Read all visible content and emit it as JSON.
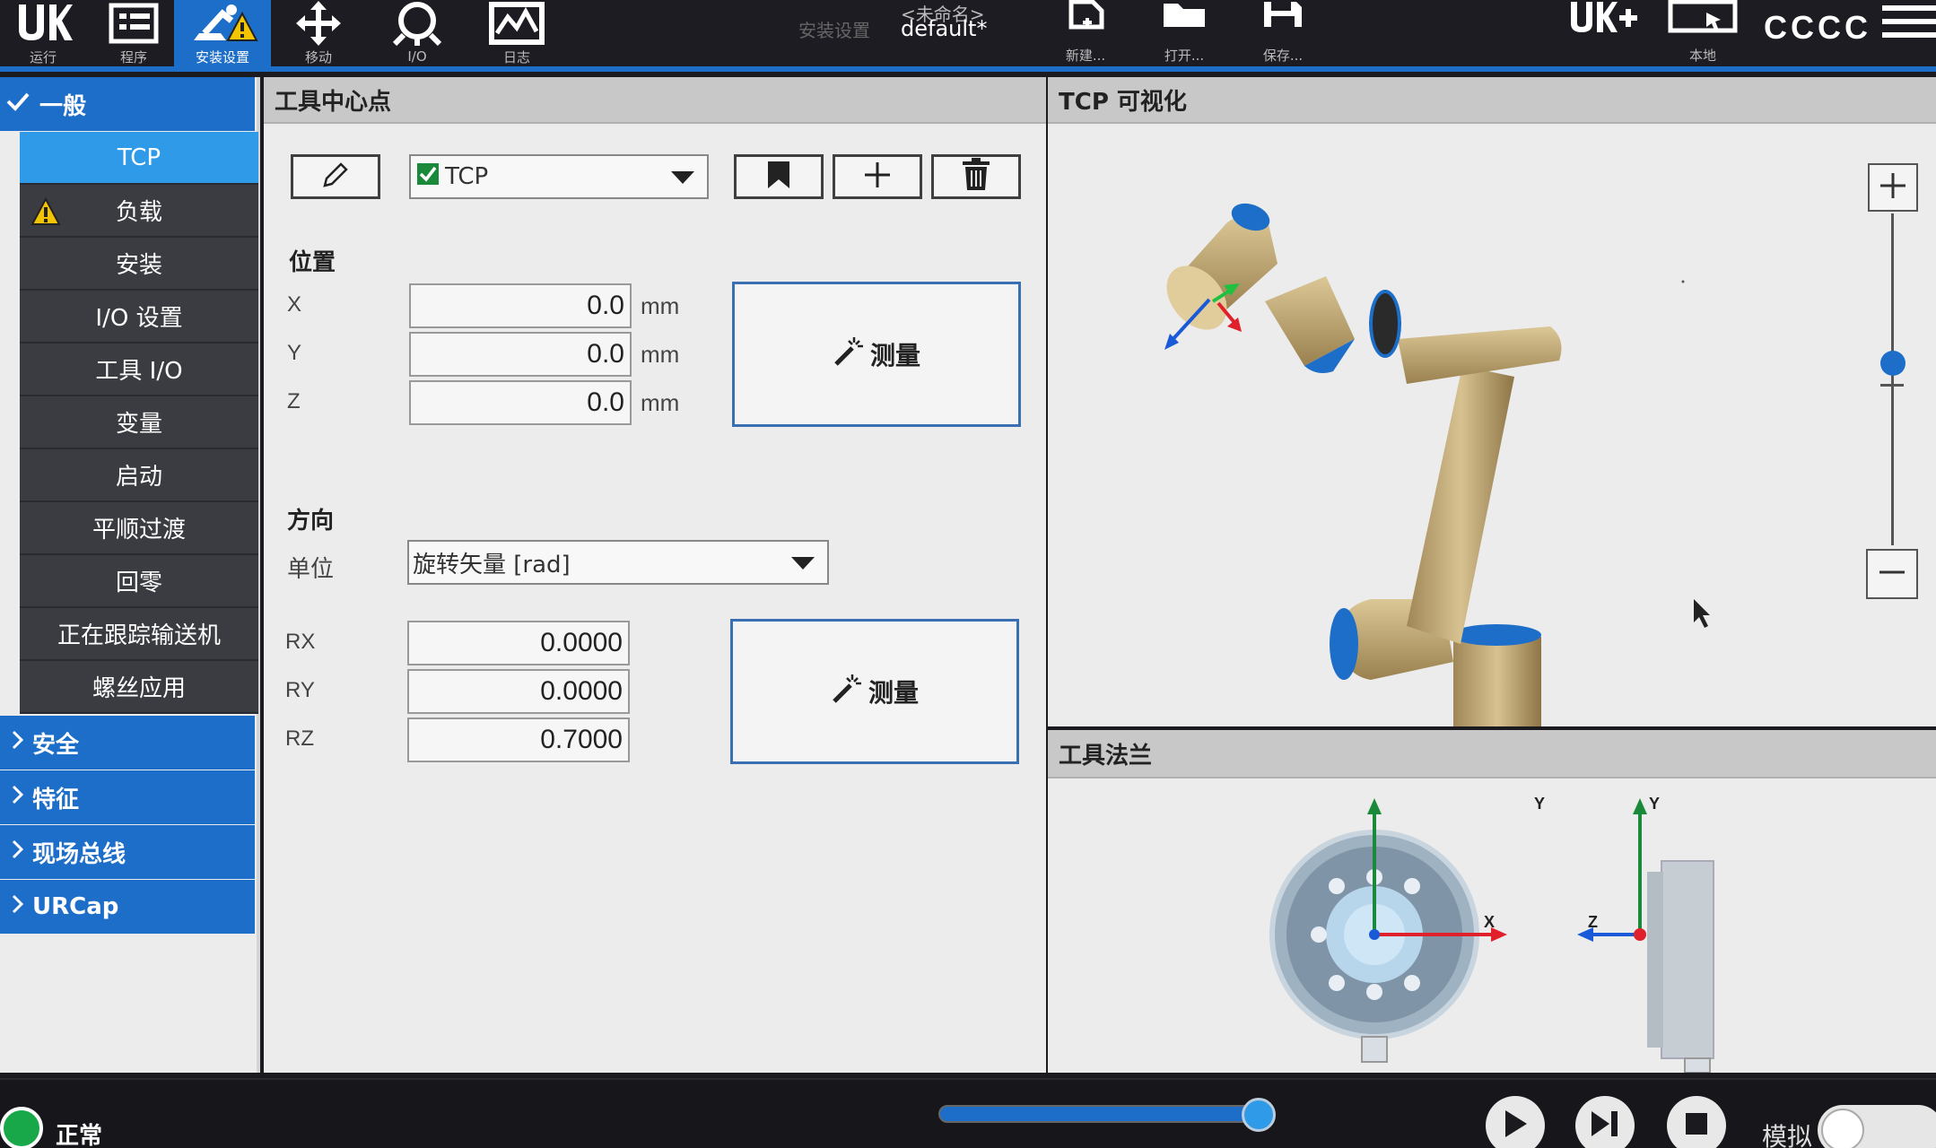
{
  "topbar": {
    "tabs": [
      {
        "label": "运行",
        "icon": "ur-logo-icon"
      },
      {
        "label": "程序",
        "icon": "program-icon"
      },
      {
        "label": "安装设置",
        "icon": "installation-icon"
      },
      {
        "label": "移动",
        "icon": "move-icon"
      },
      {
        "label": "I/O",
        "icon": "io-icon"
      },
      {
        "label": "日志",
        "icon": "log-icon"
      }
    ],
    "installation_caption": "安装设置",
    "program_name": "<未命名>",
    "installation_name": "default*",
    "file_actions": [
      {
        "label": "新建...",
        "icon": "new-file-icon"
      },
      {
        "label": "打开...",
        "icon": "open-folder-icon"
      },
      {
        "label": "保存...",
        "icon": "save-icon"
      }
    ],
    "ur_plus_icon": "ur-plus-icon",
    "local_label": "本地",
    "robot_name": "CCCC",
    "menu_icon": "hamburger-menu-icon"
  },
  "sidebar": {
    "groups": [
      {
        "label": "一般",
        "expanded": true
      },
      {
        "label": "安全",
        "expanded": false
      },
      {
        "label": "特征",
        "expanded": false
      },
      {
        "label": "现场总线",
        "expanded": false
      },
      {
        "label": "URCap",
        "expanded": false
      }
    ],
    "items": [
      {
        "label": "TCP",
        "active": true
      },
      {
        "label": "负载",
        "warning": true
      },
      {
        "label": "安装"
      },
      {
        "label": "I/O 设置"
      },
      {
        "label": "工具 I/O"
      },
      {
        "label": "变量"
      },
      {
        "label": "启动"
      },
      {
        "label": "平顺过渡"
      },
      {
        "label": "回零"
      },
      {
        "label": "正在跟踪输送机"
      },
      {
        "label": "螺丝应用"
      }
    ]
  },
  "tcp_panel": {
    "title": "工具中心点",
    "tcp_select": {
      "value": "TCP",
      "checked": true
    },
    "position_label": "位置",
    "position": [
      {
        "axis": "X",
        "value": "0.0",
        "unit": "mm"
      },
      {
        "axis": "Y",
        "value": "0.0",
        "unit": "mm"
      },
      {
        "axis": "Z",
        "value": "0.0",
        "unit": "mm"
      }
    ],
    "measure_label": "测量",
    "orientation_label": "方向",
    "unit_label": "单位",
    "unit_select": "旋转矢量 [rad]",
    "orientation": [
      {
        "axis": "RX",
        "value": "0.0000"
      },
      {
        "axis": "RY",
        "value": "0.0000"
      },
      {
        "axis": "RZ",
        "value": "0.7000"
      }
    ]
  },
  "visualization": {
    "title": "TCP 可视化",
    "zoom_level_fraction": 0.55
  },
  "flange": {
    "title": "工具法兰",
    "front_axes": {
      "y": "Y",
      "x": "X"
    },
    "side_axes": {
      "y": "Y",
      "z": "Z"
    }
  },
  "bottombar": {
    "status": "正常",
    "speed_fraction": 1.0,
    "sim_label": "模拟"
  },
  "colors": {
    "accent_blue": "#1d6ec8",
    "active_item": "#2f9be8",
    "status_green": "#18a84a",
    "axis_x": "#e0202a",
    "axis_y": "#1a8a3a",
    "axis_z": "#1a5ad8"
  }
}
